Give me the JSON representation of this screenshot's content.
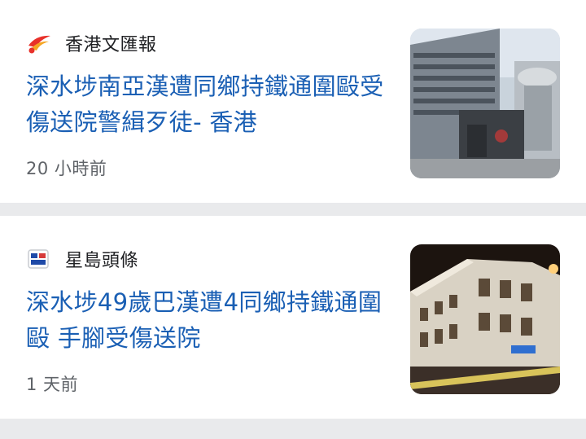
{
  "articles": [
    {
      "source": "香港文匯報",
      "source_icon": "wenweipo-logo-icon",
      "headline": "深水埗南亞漢遭同鄉持鐵通圍毆受傷送院警緝歹徒- 香港",
      "time": "20 小時前",
      "thumbnail": "police-station-building-image"
    },
    {
      "source": "星島頭條",
      "source_icon": "singtao-logo-icon",
      "headline": "深水埗49歲巴漢遭4同鄉持鐵通圍毆 手腳受傷送院",
      "time": "1 天前",
      "thumbnail": "police-station-night-image"
    }
  ],
  "colors": {
    "headline": "#1a5fb4",
    "source_text": "#202124",
    "time_text": "#5f6368",
    "divider": "#e9eaec"
  }
}
